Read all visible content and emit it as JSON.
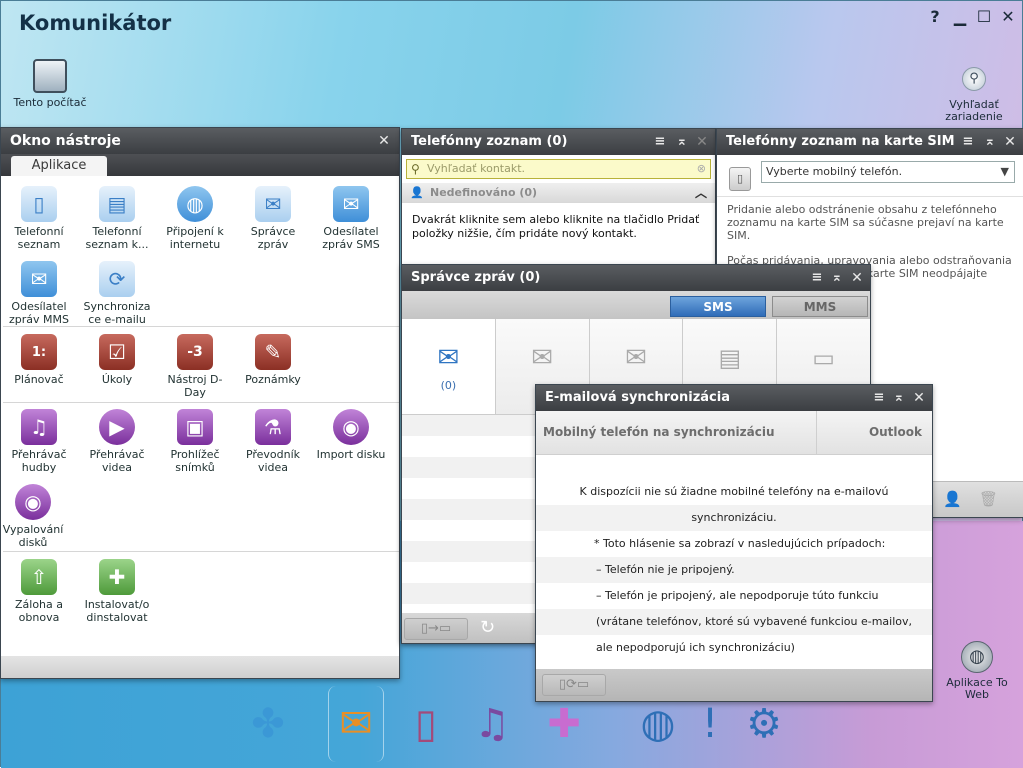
{
  "app": {
    "title": "Komunikátor",
    "help": "?",
    "minimize": "▁",
    "maximize": "☐",
    "close": "✕"
  },
  "desktop": {
    "this_computer": "Tento počítač",
    "find_device": "Vyhľadať zariadenie",
    "web_apps": "Aplikace To Web"
  },
  "tool_window": {
    "title": "Okno nástroje",
    "tab": "Aplikace",
    "apps": [
      {
        "label": "Telefonní seznam",
        "icon": "phonebook-icon"
      },
      {
        "label": "Telefonní seznam k...",
        "icon": "sim-phonebook-icon"
      },
      {
        "label": "Připojení k internetu",
        "icon": "globe-icon"
      },
      {
        "label": "Správce zpráv",
        "icon": "message-manager-icon"
      },
      {
        "label": "Odesílatel zpráv SMS",
        "icon": "sms-sender-icon"
      },
      {
        "label": "Odesílatel zpráv MMS",
        "icon": "mms-sender-icon"
      },
      {
        "label": "Synchroniza ce e-mailu",
        "icon": "email-sync-icon"
      },
      {
        "label": "Plánovač",
        "icon": "calendar-icon"
      },
      {
        "label": "Úkoly",
        "icon": "tasks-icon"
      },
      {
        "label": "Nástroj D-Day",
        "icon": "dday-icon"
      },
      {
        "label": "Poznámky",
        "icon": "notes-icon"
      },
      {
        "label": "Přehrávač hudby",
        "icon": "music-note-icon"
      },
      {
        "label": "Přehrávač videa",
        "icon": "video-player-icon"
      },
      {
        "label": "Prohlížeč snímků",
        "icon": "image-viewer-icon"
      },
      {
        "label": "Převodník videa",
        "icon": "video-converter-icon"
      },
      {
        "label": "Import disku",
        "icon": "disc-import-icon"
      },
      {
        "label": "Vypalování disků",
        "icon": "disc-burn-icon"
      },
      {
        "label": "Záloha a obnova",
        "icon": "backup-icon"
      },
      {
        "label": "Instalovat/o dinstalovat",
        "icon": "install-icon"
      }
    ]
  },
  "phonebook": {
    "title": "Telefónny zoznam (0)",
    "search_placeholder": "Vyhľadať kontakt.",
    "group": "Nedefinováno (0)",
    "hint": "Dvakrát kliknite sem alebo kliknite na tlačidlo Pridať položky nižšie, čím pridáte nový kontakt."
  },
  "sim": {
    "title": "Telefónny zoznam na karte SIM",
    "select": "Vyberte mobilný telefón.",
    "text1": "Pridanie alebo odstránenie obsahu z telefónneho zoznamu na karte SIM sa súčasne prejaví na karte SIM.",
    "text2": "Počas pridávania, upravovania alebo odstraňovania telefónneho zoznamu na karte SIM neodpájajte mobilný"
  },
  "messages": {
    "title": "Správce zpráv (0)",
    "tab_sms": "SMS",
    "tab_mms": "MMS",
    "inbox_count": "(0)"
  },
  "email_sync": {
    "title": "E-mailová synchronizácia",
    "col_phone": "Mobilný telefón na synchronizáciu",
    "col_outlook": "Outlook",
    "none": "K dispozícii nie sú žiadne mobilné telefóny na e-mailovú synchronizáciu.",
    "note": "* Toto hlásenie sa zobrazí v nasledujúcich prípadoch:",
    "case1": "– Telefón nie je pripojený.",
    "case2": "– Telefón je pripojený, ale nepodporuje túto funkciu",
    "case3": "(vrátane telefónov, ktoré sú vybavené funkciou e-mailov,",
    "case4": "ale nepodporujú ich synchronizáciu)"
  }
}
